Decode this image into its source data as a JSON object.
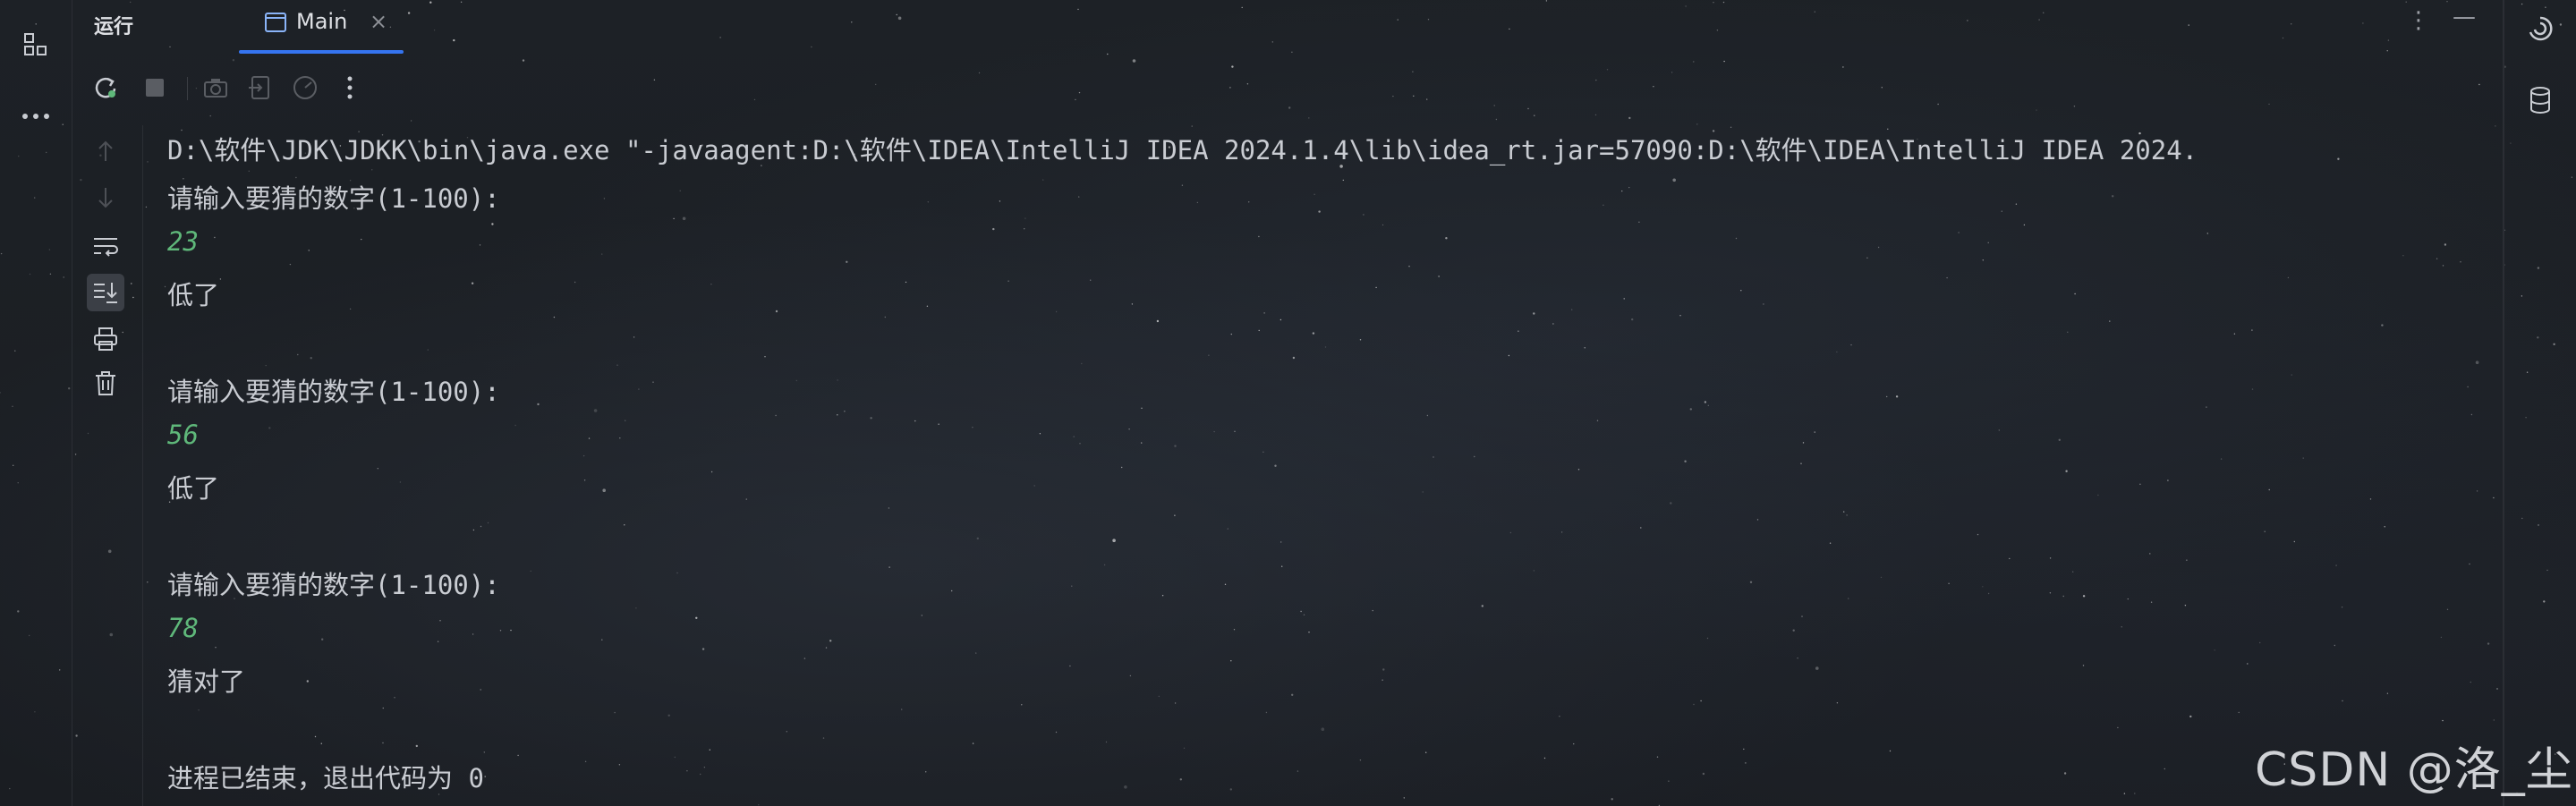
{
  "header": {
    "run_label": "运行",
    "tab_label": "Main",
    "tab_close": "×",
    "more": "⋮",
    "minimize": "—"
  },
  "console": {
    "lines": [
      {
        "text": "D:\\软件\\JDK\\JDKK\\bin\\java.exe \"-javaagent:D:\\软件\\IDEA\\IntelliJ IDEA 2024.1.4\\lib\\idea_rt.jar=57090:D:\\软件\\IDEA\\IntelliJ IDEA 2024.",
        "kind": "output"
      },
      {
        "text": "请输入要猜的数字(1-100):",
        "kind": "output"
      },
      {
        "text": "23",
        "kind": "input"
      },
      {
        "text": "低了",
        "kind": "output"
      },
      {
        "text": "",
        "kind": "output"
      },
      {
        "text": "请输入要猜的数字(1-100):",
        "kind": "output"
      },
      {
        "text": "56",
        "kind": "input"
      },
      {
        "text": "低了",
        "kind": "output"
      },
      {
        "text": "",
        "kind": "output"
      },
      {
        "text": "请输入要猜的数字(1-100):",
        "kind": "output"
      },
      {
        "text": "78",
        "kind": "input"
      },
      {
        "text": "猜对了",
        "kind": "output"
      },
      {
        "text": "",
        "kind": "output"
      },
      {
        "text": "进程已结束，退出代码为 0",
        "kind": "output"
      }
    ]
  },
  "watermark": "CSDN @洛_尘",
  "colors": {
    "accent": "#3574f0",
    "input_text": "#5fb87a",
    "output_text": "#c9ccd2",
    "rerun_icon": "#5fb87a"
  },
  "icons": {
    "left_strip": [
      "project-structure-icon",
      "more-tools-icon"
    ],
    "right_strip": [
      "ai-assistant-icon",
      "database-icon"
    ],
    "toolbar": [
      "rerun-icon",
      "stop-icon",
      "screenshot-icon",
      "exit-icon",
      "gauge-icon",
      "more-options-icon"
    ],
    "gutter": [
      "scroll-up-icon",
      "scroll-down-icon",
      "soft-wrap-icon",
      "scroll-to-end-icon",
      "print-icon",
      "clear-icon"
    ]
  }
}
